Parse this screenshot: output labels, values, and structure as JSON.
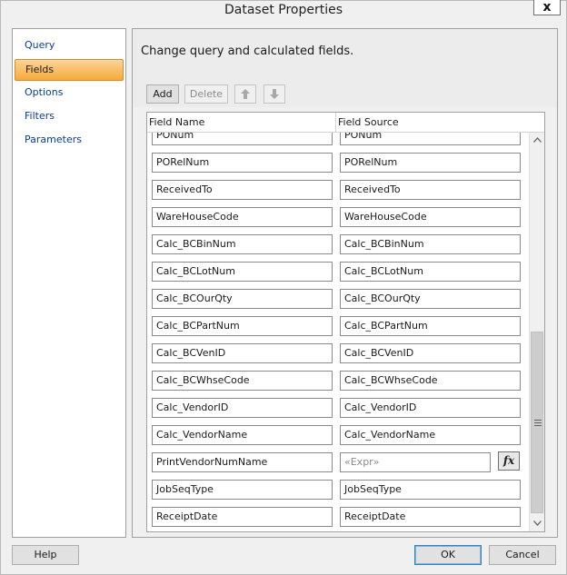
{
  "window": {
    "title": "Dataset Properties",
    "close_label": "x"
  },
  "nav": {
    "items": [
      {
        "label": "Query",
        "selected": false
      },
      {
        "label": "Fields",
        "selected": true
      },
      {
        "label": "Options",
        "selected": false
      },
      {
        "label": "Filters",
        "selected": false
      },
      {
        "label": "Parameters",
        "selected": false
      }
    ]
  },
  "main": {
    "description": "Change query and calculated fields.",
    "toolbar": {
      "add_label": "Add",
      "delete_label": "Delete"
    },
    "grid": {
      "columns": [
        "Field Name",
        "Field Source"
      ],
      "rows": [
        {
          "name": "PONum",
          "source": "PONum"
        },
        {
          "name": "PORelNum",
          "source": "PORelNum"
        },
        {
          "name": "ReceivedTo",
          "source": "ReceivedTo"
        },
        {
          "name": "WareHouseCode",
          "source": "WareHouseCode"
        },
        {
          "name": "Calc_BCBinNum",
          "source": "Calc_BCBinNum"
        },
        {
          "name": "Calc_BCLotNum",
          "source": "Calc_BCLotNum"
        },
        {
          "name": "Calc_BCOurQty",
          "source": "Calc_BCOurQty"
        },
        {
          "name": "Calc_BCPartNum",
          "source": "Calc_BCPartNum"
        },
        {
          "name": "Calc_BCVenID",
          "source": "Calc_BCVenID"
        },
        {
          "name": "Calc_BCWhseCode",
          "source": "Calc_BCWhseCode"
        },
        {
          "name": "Calc_VendorID",
          "source": "Calc_VendorID"
        },
        {
          "name": "Calc_VendorName",
          "source": "Calc_VendorName"
        },
        {
          "name": "PrintVendorNumName",
          "source": "",
          "source_placeholder": "«Expr»",
          "calculated": true
        },
        {
          "name": "JobSeqType",
          "source": "JobSeqType"
        },
        {
          "name": "ReceiptDate",
          "source": "ReceiptDate"
        }
      ],
      "fx_label": "fx"
    }
  },
  "footer": {
    "help_label": "Help",
    "ok_label": "OK",
    "cancel_label": "Cancel"
  },
  "icons": {
    "move_up": "arrow-up-icon",
    "move_down": "arrow-down-icon",
    "scroll_up": "chevron-up-icon",
    "scroll_down": "chevron-down-icon",
    "expression": "fx-icon"
  }
}
